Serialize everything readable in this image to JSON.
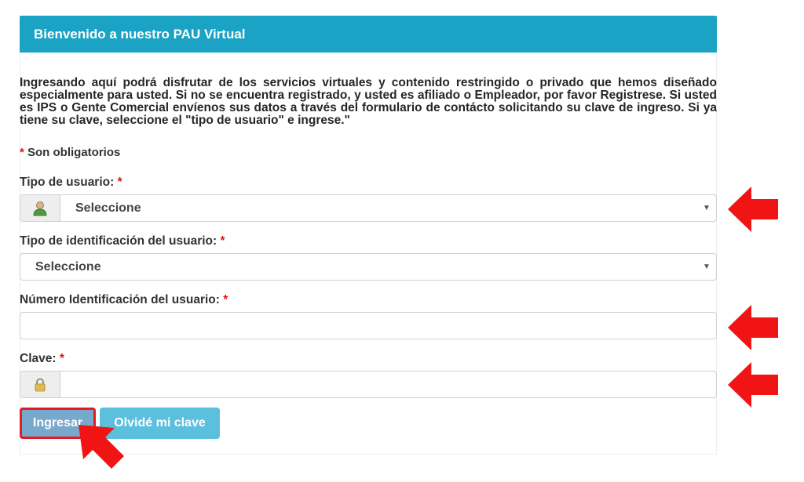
{
  "header": {
    "title": "Bienvenido a nuestro PAU Virtual"
  },
  "intro": {
    "text": "Ingresando aquí podrá disfrutar de los servicios virtuales y contenido restringido o privado que hemos diseñado especialmente para usted. Si no se encuentra registrado, y usted es afiliado o Empleador, por favor Registrese. Si usted es IPS o Gente Comercial envíenos sus datos a través del formulario de contácto solicitando su clave de ingreso. Si ya tiene su clave, seleccione el \"tipo de usuario\" e ingrese.\""
  },
  "required_note": {
    "star": "*",
    "text": "Son obligatorios"
  },
  "form": {
    "tipo_usuario": {
      "label": "Tipo de usuario:",
      "star": "*",
      "selected": "Seleccione"
    },
    "tipo_identificacion": {
      "label": "Tipo de identificación del usuario:",
      "star": "*",
      "selected": "Seleccione"
    },
    "numero_identificacion": {
      "label": "Número Identificación del usuario:",
      "star": "*",
      "value": ""
    },
    "clave": {
      "label": "Clave:",
      "star": "*",
      "value": ""
    }
  },
  "buttons": {
    "ingresar": "Ingresar",
    "olvide": "Olvidé mi clave"
  },
  "colors": {
    "header": "#1aa3c4",
    "required": "#d9161c",
    "arrow": "#f01414",
    "primary_button": "#79a8cd",
    "info_button": "#5bc0de"
  },
  "icons": {
    "user": "user-icon",
    "lock": "lock-icon",
    "caret": "caret-down-icon",
    "arrow": "red-arrow-icon"
  }
}
